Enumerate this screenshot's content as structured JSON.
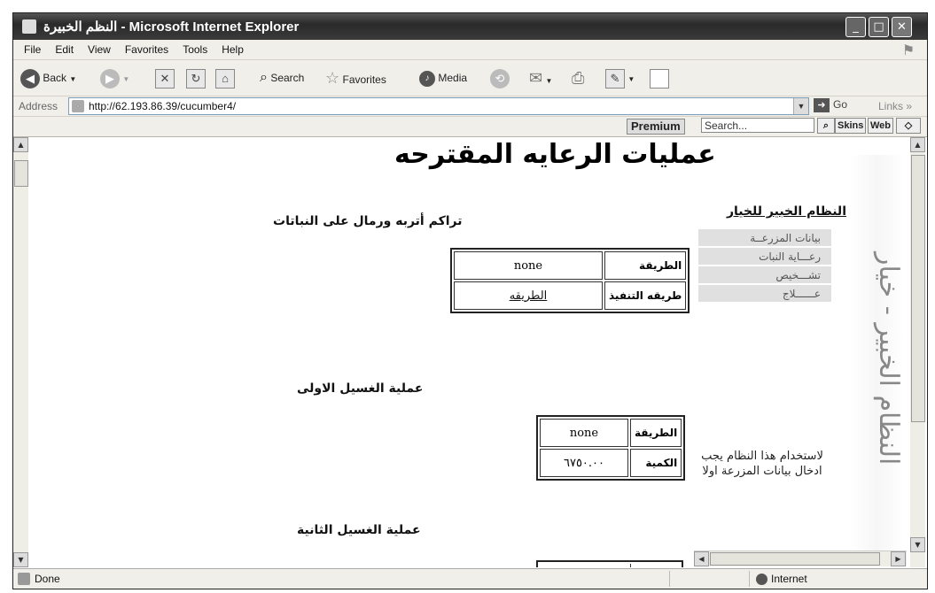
{
  "window": {
    "title": "النظم الخبيرة - Microsoft Internet Explorer",
    "controls": [
      "_",
      "□",
      "✕"
    ]
  },
  "menu": [
    "File",
    "Edit",
    "View",
    "Favorites",
    "Tools",
    "Help"
  ],
  "toolbar": {
    "back_label": "Back",
    "search_label": "Search",
    "favorites_label": "Favorites",
    "media_label": "Media"
  },
  "address": {
    "label": "Address",
    "url": "http://62.193.86.39/cucumber4/",
    "go_label": "Go",
    "links_label": "Links"
  },
  "google_toolbar": {
    "premium_label": "Premium",
    "search_placeholder": "Search...",
    "skins_label": "Skins",
    "web_label": "Web"
  },
  "page": {
    "title": "عمليات الرعايه المقترحه",
    "sections": [
      {
        "heading": "تراكم أتربه ورمال على النباتات",
        "rows": [
          {
            "key": "الطريقة",
            "value": "none"
          },
          {
            "key": "طريقه التنفيذ",
            "value": "الطريقه",
            "link": true
          }
        ]
      },
      {
        "heading": "عملية الغسيل الاولى",
        "rows": [
          {
            "key": "الطريقة",
            "value": "none"
          },
          {
            "key": "الكمية",
            "value": "٦٧٥٠.٠٠"
          }
        ]
      },
      {
        "heading": "عملية الغسيل الثانية",
        "rows": []
      }
    ],
    "sidebar": {
      "heading": "النظام الخبير للخيار",
      "nav": [
        "بيانات المزرعــة",
        "رعـــاية النبات",
        "تشـــخيص",
        "عــــــلاج"
      ],
      "note": "لاستخدام هذا النظام يجب ادخال بيانات المزرعة اولا",
      "banner_text": "النظام الخبير - خيار"
    }
  },
  "status": {
    "text": "Done",
    "zone": "Internet"
  }
}
